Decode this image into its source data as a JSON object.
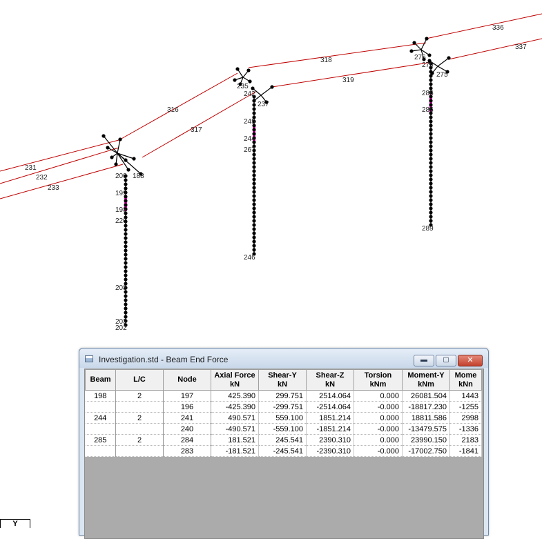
{
  "model": {
    "beam_labels": [
      "336",
      "337",
      "318",
      "319",
      "316",
      "317",
      "231",
      "232",
      "233"
    ],
    "node_labels": [
      "276",
      "235",
      "237",
      "242",
      "244",
      "245",
      "267",
      "246",
      "286",
      "285",
      "270",
      "275",
      "289",
      "199",
      "198",
      "188",
      "202",
      "203",
      "220",
      "208",
      "200"
    ],
    "member_color": "#c00000",
    "highlight_color": "#ff00cc"
  },
  "axis_label": "Y",
  "window": {
    "title": "Investigation.std - Beam End Force",
    "buttons": {
      "minimize": "▬",
      "maximize": "▢",
      "close": "✕"
    }
  },
  "table": {
    "columns": [
      {
        "name": "Beam",
        "unit": ""
      },
      {
        "name": "L/C",
        "unit": ""
      },
      {
        "name": "Node",
        "unit": ""
      },
      {
        "name": "Axial Force",
        "unit": "kN"
      },
      {
        "name": "Shear-Y",
        "unit": "kN"
      },
      {
        "name": "Shear-Z",
        "unit": "kN"
      },
      {
        "name": "Torsion",
        "unit": "kNm"
      },
      {
        "name": "Moment-Y",
        "unit": "kNm"
      },
      {
        "name": "Mome",
        "unit": "kNn"
      }
    ],
    "rows": [
      {
        "beam": "198",
        "lc": "2",
        "node": "197",
        "axial": "425.390",
        "shear_y": "299.751",
        "shear_z": "2514.064",
        "torsion": "0.000",
        "moment_y": "26081.504",
        "moment_z": "1443"
      },
      {
        "beam": "",
        "lc": "",
        "node": "196",
        "axial": "-425.390",
        "shear_y": "-299.751",
        "shear_z": "-2514.064",
        "torsion": "-0.000",
        "moment_y": "-18817.230",
        "moment_z": "-1255"
      },
      {
        "beam": "244",
        "lc": "2",
        "node": "241",
        "axial": "490.571",
        "shear_y": "559.100",
        "shear_z": "1851.214",
        "torsion": "0.000",
        "moment_y": "18811.586",
        "moment_z": "2998"
      },
      {
        "beam": "",
        "lc": "",
        "node": "240",
        "axial": "-490.571",
        "shear_y": "-559.100",
        "shear_z": "-1851.214",
        "torsion": "-0.000",
        "moment_y": "-13479.575",
        "moment_z": "-1336"
      },
      {
        "beam": "285",
        "lc": "2",
        "node": "284",
        "axial": "181.521",
        "shear_y": "245.541",
        "shear_z": "2390.310",
        "torsion": "0.000",
        "moment_y": "23990.150",
        "moment_z": "2183"
      },
      {
        "beam": "",
        "lc": "",
        "node": "283",
        "axial": "-181.521",
        "shear_y": "-245.541",
        "shear_z": "-2390.310",
        "torsion": "-0.000",
        "moment_y": "-17002.750",
        "moment_z": "-1841"
      }
    ]
  }
}
